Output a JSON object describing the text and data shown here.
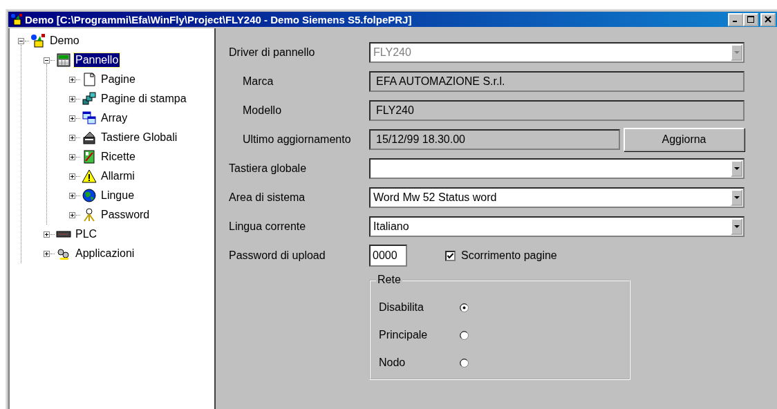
{
  "window": {
    "title": "Demo [C:\\Programmi\\Efa\\WinFly\\Project\\FLY240 - Demo Siemens S5.folpePRJ]"
  },
  "tree": [
    {
      "label": "Demo",
      "kind": "project",
      "expanded": true,
      "selected": false,
      "children": [
        {
          "label": "Pannello",
          "kind": "panel",
          "expanded": true,
          "selected": true,
          "children": [
            {
              "label": "Pagine",
              "kind": "pages",
              "expanded": false,
              "selected": false
            },
            {
              "label": "Pagine di stampa",
              "kind": "print",
              "expanded": false,
              "selected": false
            },
            {
              "label": "Array",
              "kind": "array",
              "expanded": false,
              "selected": false
            },
            {
              "label": "Tastiere Globali",
              "kind": "keyboard",
              "expanded": false,
              "selected": false
            },
            {
              "label": "Ricette",
              "kind": "recipe",
              "expanded": false,
              "selected": false
            },
            {
              "label": "Allarmi",
              "kind": "alarm",
              "expanded": false,
              "selected": false
            },
            {
              "label": "Lingue",
              "kind": "language",
              "expanded": false,
              "selected": false
            },
            {
              "label": "Password",
              "kind": "password",
              "expanded": false,
              "selected": false
            }
          ]
        },
        {
          "label": "PLC",
          "kind": "plc",
          "expanded": false,
          "selected": false
        },
        {
          "label": "Applicazioni",
          "kind": "apps",
          "expanded": false,
          "selected": false
        }
      ]
    }
  ],
  "form": {
    "rows": [
      {
        "kind": "combo",
        "label": "Driver di pannello",
        "value": "FLY240",
        "disabled": true,
        "indented": false
      },
      {
        "kind": "readonly",
        "label": "Marca",
        "value": "EFA AUTOMAZIONE S.r.l.",
        "indented": true
      },
      {
        "kind": "readonly",
        "label": "Modello",
        "value": "FLY240",
        "indented": true
      },
      {
        "kind": "readonly",
        "label": "Ultimo aggiornamento",
        "value": "15/12/99 18.30.00",
        "indented": true,
        "button": "Aggiorna"
      },
      {
        "kind": "combo",
        "label": "Tastiera globale",
        "disabled": false,
        "indented": false
      },
      {
        "kind": "combo",
        "label": "Area di sistema",
        "value": "Word Mw 52 Status word",
        "disabled": false,
        "indented": false
      },
      {
        "kind": "combo",
        "label": "Lingua corrente",
        "value": "Italiano",
        "disabled": false,
        "indented": false
      },
      {
        "kind": "text",
        "label": "Password di upload",
        "value": "0000",
        "indented": false,
        "checkbox": {
          "label": "Scorrimento pagine",
          "checked": true
        }
      }
    ],
    "network": {
      "title": "Rete",
      "options": [
        {
          "label": "Disabilita",
          "selected": true
        },
        {
          "label": "Principale",
          "selected": false
        },
        {
          "label": "Nodo",
          "selected": false
        }
      ]
    }
  }
}
